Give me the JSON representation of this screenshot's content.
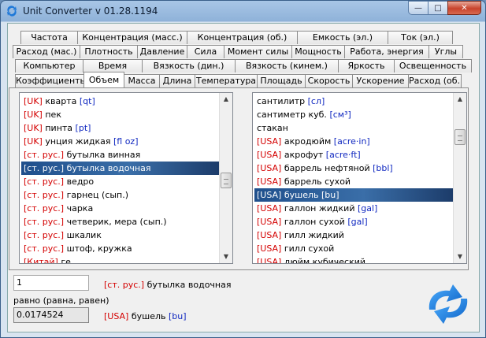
{
  "window": {
    "title": "Unit Converter v 01.28.1194",
    "close_icon": "✕",
    "maximize_icon": "□",
    "minimize_icon": "—"
  },
  "colors": {
    "tag_red": "#d40000",
    "abbr_blue": "#1028c0",
    "selection": "#2a5a96"
  },
  "tabs": {
    "row1": [
      "Частота",
      "Концентрация (масс.)",
      "Концентрация (об.)",
      "Емкость (эл.)",
      "Ток (эл.)"
    ],
    "row2": [
      "Расход (мас.)",
      "Плотность",
      "Давление",
      "Сила",
      "Момент силы",
      "Мощность",
      "Работа, энергия",
      "Углы"
    ],
    "row3": [
      "Компьютер",
      "Время",
      "Вязкость (дин.)",
      "Вязкость (кинем.)",
      "Яркость",
      "Освещенность"
    ],
    "row4": [
      "Коэффициенты",
      "Объем",
      "Масса",
      "Длина",
      "Температура",
      "Площадь",
      "Скорость",
      "Ускорение",
      "Расход (об.)"
    ],
    "active": "Объем"
  },
  "left_list": [
    {
      "tag": "[UK]",
      "name": "кварта",
      "abbr": "[qt]"
    },
    {
      "tag": "[UK]",
      "name": "пек",
      "abbr": ""
    },
    {
      "tag": "[UK]",
      "name": "пинта",
      "abbr": "[pt]"
    },
    {
      "tag": "[UK]",
      "name": "унция жидкая",
      "abbr": "[fl oz]"
    },
    {
      "tag": "[ст. рус.]",
      "name": "бутылка винная",
      "abbr": ""
    },
    {
      "tag": "[ст. рус.]",
      "name": "бутылка водочная",
      "abbr": "",
      "selected": true
    },
    {
      "tag": "[ст. рус.]",
      "name": "ведро",
      "abbr": ""
    },
    {
      "tag": "[ст. рус.]",
      "name": "гарнец (сып.)",
      "abbr": ""
    },
    {
      "tag": "[ст. рус.]",
      "name": "чарка",
      "abbr": ""
    },
    {
      "tag": "[ст. рус.]",
      "name": "четверик, мера (сып.)",
      "abbr": ""
    },
    {
      "tag": "[ст. рус.]",
      "name": "шкалик",
      "abbr": ""
    },
    {
      "tag": "[ст. рус.]",
      "name": "штоф, кружка",
      "abbr": ""
    },
    {
      "tag": "[Китай]",
      "name": "ге",
      "abbr": ""
    }
  ],
  "right_list": [
    {
      "tag": "",
      "name": "сантилитр",
      "abbr": "[сл]"
    },
    {
      "tag": "",
      "name": "сантиметр куб.",
      "abbr": "[см³]"
    },
    {
      "tag": "",
      "name": "стакан",
      "abbr": ""
    },
    {
      "tag": "[USA]",
      "name": "акродюйм",
      "abbr": "[acre·in]"
    },
    {
      "tag": "[USA]",
      "name": "акрофут",
      "abbr": "[acre·ft]"
    },
    {
      "tag": "[USA]",
      "name": "баррель нефтяной",
      "abbr": "[bbl]"
    },
    {
      "tag": "[USA]",
      "name": "баррель сухой",
      "abbr": ""
    },
    {
      "tag": "[USA]",
      "name": "бушель",
      "abbr": "[bu]",
      "selected": true
    },
    {
      "tag": "[USA]",
      "name": "галлон жидкий",
      "abbr": "[gal]"
    },
    {
      "tag": "[USA]",
      "name": "галлон сухой",
      "abbr": "[gal]"
    },
    {
      "tag": "[USA]",
      "name": "гилл жидкий",
      "abbr": ""
    },
    {
      "tag": "[USA]",
      "name": "гилл сухой",
      "abbr": ""
    },
    {
      "tag": "[USA]",
      "name": "дюйм кубический",
      "abbr": ""
    }
  ],
  "converter": {
    "input_value": "1",
    "from_tag": "[ст. рус.]",
    "from_name": "бутылка водочная",
    "equals_label": "равно (равна, равен)",
    "result_value": "0.0174524",
    "to_tag": "[USA]",
    "to_name": "бушель",
    "to_abbr": "[bu]"
  }
}
